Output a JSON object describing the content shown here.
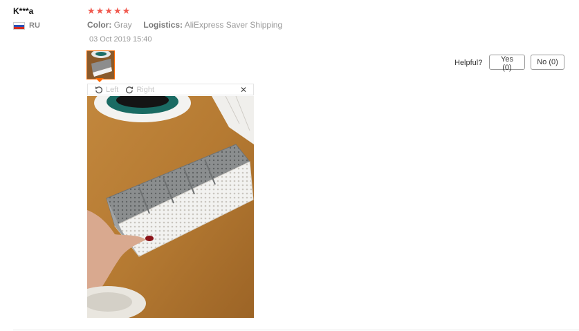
{
  "review": {
    "user_name": "K***a",
    "country_code": "RU",
    "rating": 5,
    "attributes": [
      {
        "label": "Color:",
        "value": "Gray"
      },
      {
        "label": "Logistics:",
        "value": "AliExpress Saver Shipping"
      }
    ],
    "date": "03 Oct 2019 15:40"
  },
  "viewer": {
    "rotate_left_label": "Left",
    "rotate_right_label": "Right",
    "close_glyph": "✕"
  },
  "feedback": {
    "helpful_label": "Helpful?",
    "yes_label": "Yes (0)",
    "no_label": "No (0)"
  },
  "colors": {
    "star": "#f0584d",
    "thumb_border": "#ff6a00",
    "muted_text": "#999999"
  },
  "icons": {
    "flag": "russia-flag-icon",
    "star": "star-icon",
    "rotate_left": "rotate-left-icon",
    "rotate_right": "rotate-right-icon",
    "close": "close-icon"
  }
}
